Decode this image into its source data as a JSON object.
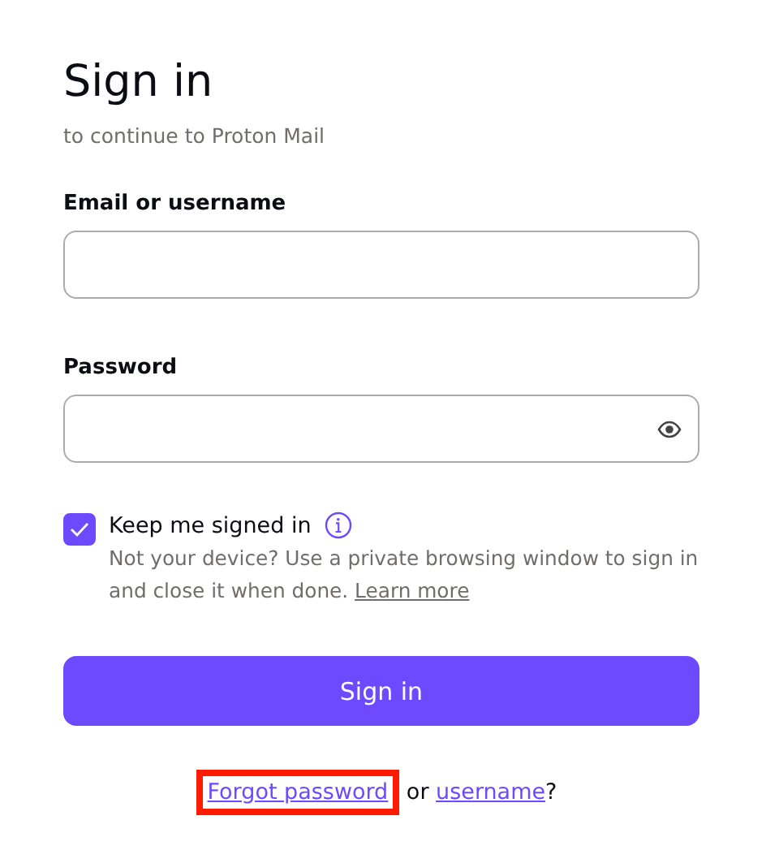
{
  "heading": {
    "title": "Sign in",
    "subtitle": "to continue to Proton Mail"
  },
  "fields": [
    {
      "label": "Email or username",
      "kind": "text"
    },
    {
      "label": "Password",
      "kind": "password"
    }
  ],
  "keep_signed_in": {
    "label": "Keep me signed in",
    "checked": true,
    "note": "Not your device? Use a private browsing window to sign in and close it when done.",
    "note_link": "Learn more"
  },
  "submit": {
    "label": "Sign in"
  },
  "recovery": [
    {
      "kind": "link",
      "text": "Forgot password",
      "highlighted": true
    },
    {
      "kind": "text",
      "text": "or"
    },
    {
      "kind": "link",
      "text": "username",
      "highlighted": false
    },
    {
      "kind": "text",
      "text": "?"
    }
  ]
}
